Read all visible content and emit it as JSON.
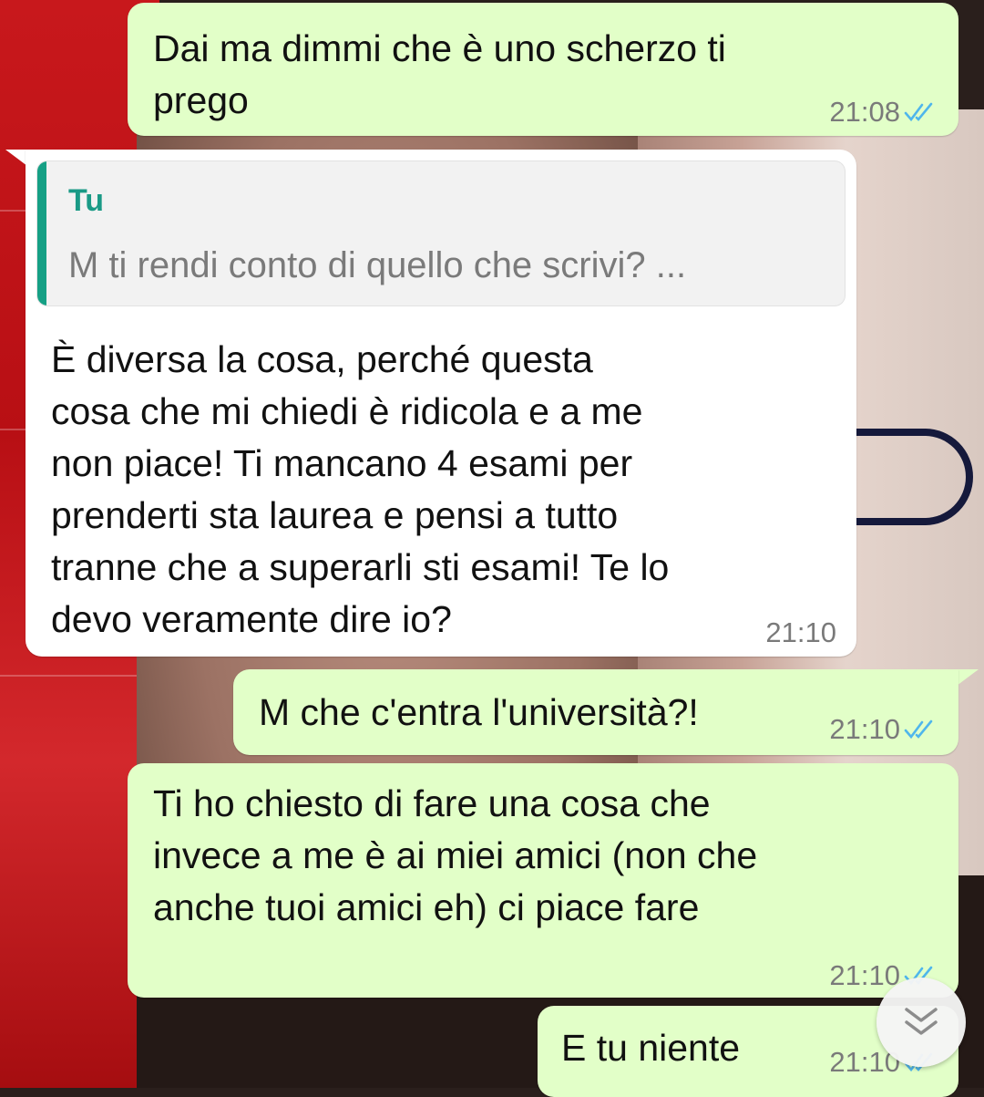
{
  "messages": [
    {
      "text": "Dai ma dimmi che è uno scherzo ti\nprego",
      "time": "21:08"
    },
    {
      "reply_author": "Tu",
      "reply_text": "M ti rendi conto di quello che scrivi? ...",
      "text": "È diversa la cosa, perché questa\ncosa che mi chiedi è ridicola e a me\nnon piace! Ti mancano 4 esami per\nprenderti sta laurea e pensi a tutto\ntranne che a superarli sti esami! Te lo\ndevo veramente dire io?",
      "time": "21:10"
    },
    {
      "text": "M che c'entra l'università?!",
      "time": "21:10"
    },
    {
      "text": "Ti ho chiesto di fare una cosa che\ninvece a me è ai miei amici (non che\nanche tuoi amici eh) ci piace fare",
      "time": "21:10"
    },
    {
      "text": "E tu niente",
      "time": "21:10"
    }
  ],
  "colors": {
    "outgoing": "#e2ffc8",
    "incoming": "#ffffff",
    "read_ticks": "#4fb6ec",
    "quote_accent": "#16a085"
  },
  "icons": {
    "read_receipt": "double-check-icon",
    "scroll_down": "double-chevron-down-icon"
  }
}
